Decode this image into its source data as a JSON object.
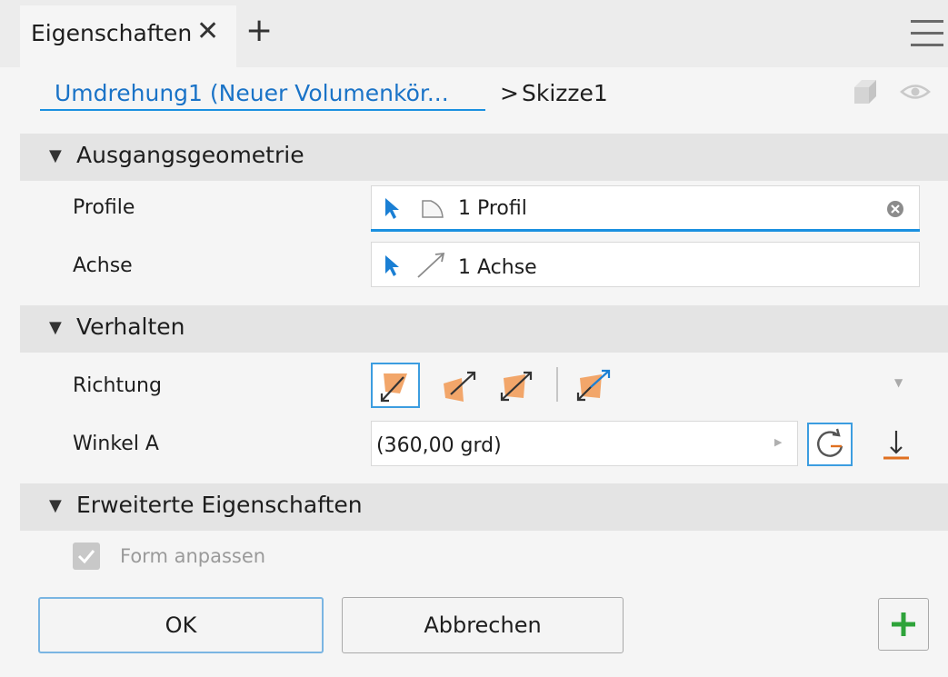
{
  "tabs": {
    "active_label": "Eigenschaften",
    "close_icon": "close-icon",
    "add_icon": "plus-icon",
    "menu_icon": "hamburger-menu-icon"
  },
  "breadcrumb": {
    "link": "Umdrehung1 (Neuer Volumenkör...",
    "separator": ">",
    "current": "Skizze1"
  },
  "sections": {
    "input_geometry": {
      "title": "Ausgangsgeometrie",
      "profile_label": "Profile",
      "profile_value": "1 Profil",
      "axis_label": "Achse",
      "axis_value": "1 Achse"
    },
    "behavior": {
      "title": "Verhalten",
      "direction_label": "Richtung",
      "angle_label": "Winkel A",
      "angle_value": "(360,00 grd)"
    },
    "advanced": {
      "title": "Erweiterte Eigenschaften",
      "fit_shape_label": "Form anpassen",
      "fit_shape_checked": true
    }
  },
  "buttons": {
    "ok": "OK",
    "cancel": "Abbrechen"
  },
  "colors": {
    "accent": "#1a90e0",
    "link": "#1a73c7",
    "direction_fill": "#f2a66a",
    "add_green": "#2ea33a"
  }
}
